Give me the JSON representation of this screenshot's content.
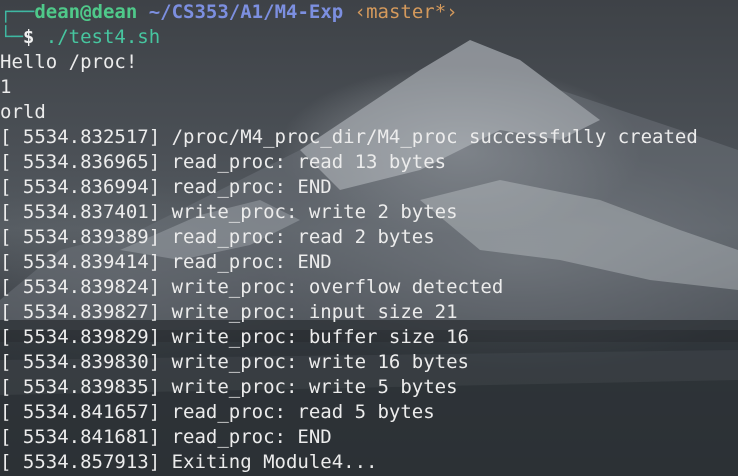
{
  "prompt": {
    "corner_top": "┌──",
    "user_host": "dean@dean",
    "path": "~/CS353/A1/M4-Exp",
    "branch": "‹master*›",
    "corner_bottom": "└─",
    "symbol": "$",
    "command": "./test4.sh"
  },
  "output": [
    "Hello /proc!",
    "1",
    "orld",
    "[ 5534.832517] /proc/M4_proc_dir/M4_proc successfully created",
    "[ 5534.836965] read_proc: read 13 bytes",
    "[ 5534.836994] read_proc: END",
    "[ 5534.837401] write_proc: write 2 bytes",
    "[ 5534.839389] read_proc: read 2 bytes",
    "[ 5534.839414] read_proc: END",
    "[ 5534.839824] write_proc: overflow detected",
    "[ 5534.839827] write_proc: input size 21",
    "[ 5534.839829] write_proc: buffer size 16",
    "[ 5534.839830] write_proc: write 16 bytes",
    "[ 5534.839835] write_proc: write 5 bytes",
    "[ 5534.841657] read_proc: read 5 bytes",
    "[ 5534.841681] read_proc: END",
    "[ 5534.857913] Exiting Module4..."
  ],
  "colors": {
    "user_host": "#4fc98a",
    "path": "#7c8fe0",
    "branch": "#d59a5c",
    "command": "#47c6a0",
    "text": "#ececec"
  }
}
